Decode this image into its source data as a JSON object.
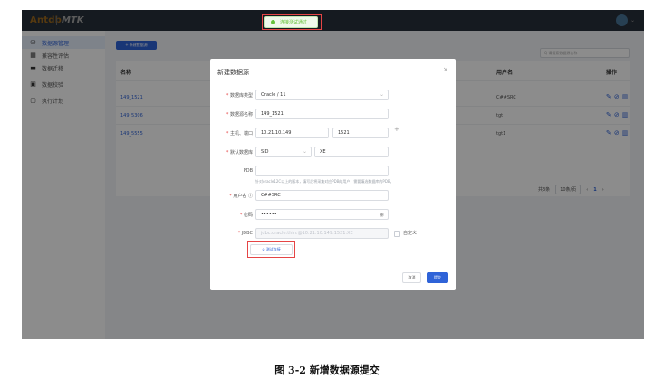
{
  "header": {
    "logo_brand": "Antdb",
    "logo_product": "MTK"
  },
  "toast": {
    "text": "连接测试通过"
  },
  "sidebar": {
    "items": [
      {
        "label": "数据源管理",
        "icon": "database-icon",
        "active": true
      },
      {
        "label": "兼容性评估",
        "icon": "assessment-icon",
        "active": false
      },
      {
        "label": "数据迁移",
        "icon": "folder-icon",
        "active": false
      },
      {
        "label": "数据校验",
        "icon": "check-icon",
        "active": false
      },
      {
        "label": "执行计划",
        "icon": "list-icon",
        "active": false
      }
    ]
  },
  "main": {
    "new_button": "+ 新建数据源",
    "search_placeholder": "Q 请搜索数据源名称",
    "table": {
      "headers": [
        "名称",
        "用户名",
        "操作"
      ],
      "rows": [
        {
          "name": "149_1521",
          "user": "C##SRC"
        },
        {
          "name": "149_5306",
          "user": "tgt"
        },
        {
          "name": "149_5555",
          "user": "tgt1"
        }
      ]
    },
    "pager": {
      "total": "共3条",
      "page_size": "10条/页",
      "current_page": "1"
    }
  },
  "modal": {
    "title": "新建数据源",
    "close": "×",
    "fields": {
      "db_type_label": "数据库类型",
      "db_type_value": "Oracle / 11",
      "ds_name_label": "数据源名称",
      "ds_name_value": "149_1521",
      "host_label": "主机、端口",
      "host_value": "10.21.10.149",
      "port_value": "1521",
      "default_db_label": "默认数据库",
      "default_db_type": "SID",
      "default_db_value": "XE",
      "pdb_label": "PDB",
      "pdb_hint": "针对oracle12C以上的版本，填写后将采集对应PDB的用户，需要填选数据库的PDB。",
      "username_label": "用户名",
      "username_value": "C##SRC",
      "password_label": "密码",
      "password_value": "••••••",
      "jdbc_label": "JDBC",
      "jdbc_value": "jdbc:oracle:thin:@10.21.10.149:1521:XE",
      "custom_label": "自定义"
    },
    "test_button": "⊘ 测试连接",
    "cancel_button": "取消",
    "submit_button": "提交"
  },
  "caption": "图 3-2  新增数据源提交",
  "colors": {
    "primary": "#2f63d8",
    "highlight": "#e54545",
    "success": "#67c23a"
  }
}
